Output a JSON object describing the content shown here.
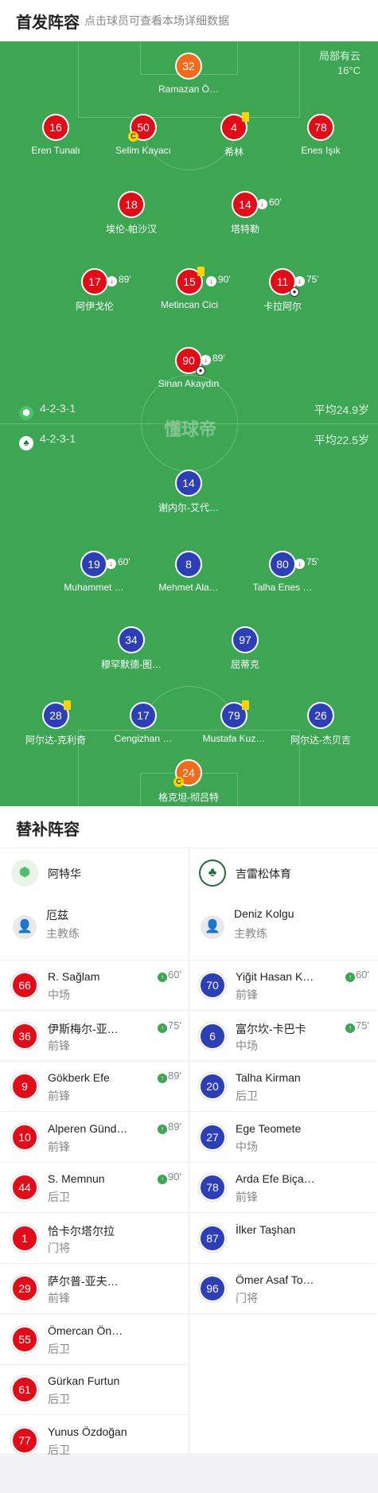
{
  "header": {
    "title": "首发阵容",
    "subtitle": "点击球员可查看本场详细数据"
  },
  "pitch": {
    "weather_label": "局部有云",
    "temperature": "16°C",
    "watermark": "懂球帝",
    "home_formation": "4-2-3-1",
    "home_avg_age": "平均24.9岁",
    "away_formation": "4-2-3-1",
    "away_avg_age": "平均22.5岁",
    "home_players": [
      {
        "num": "32",
        "name": "Ramazan Ö…",
        "role": "gk"
      },
      {
        "num": "16",
        "name": "Eren Tunalı"
      },
      {
        "num": "50",
        "name": "Selim Kayacı",
        "captain": "C"
      },
      {
        "num": "4",
        "name": "希林",
        "yellow": true
      },
      {
        "num": "78",
        "name": "Enes Işık"
      },
      {
        "num": "18",
        "name": "埃伦-帕沙汉"
      },
      {
        "num": "14",
        "name": "塔特勒",
        "sub_off": "60'"
      },
      {
        "num": "17",
        "name": "阿伊戈伦",
        "sub_off": "89'"
      },
      {
        "num": "15",
        "name": "Metincan Cici",
        "yellow": true,
        "sub_off": "90'"
      },
      {
        "num": "11",
        "name": "卡拉阿尔",
        "sub_off": "75'",
        "goal": true
      },
      {
        "num": "90",
        "name": "Sinan Akaydın",
        "sub_off": "89'",
        "goal": true
      }
    ],
    "away_players": [
      {
        "num": "14",
        "name": "谢内尔-艾代…"
      },
      {
        "num": "19",
        "name": "Muhammet …",
        "sub_off": "60'"
      },
      {
        "num": "8",
        "name": "Mehmet Ala…"
      },
      {
        "num": "80",
        "name": "Talha Enes …",
        "sub_off": "75'"
      },
      {
        "num": "34",
        "name": "穆罕默德-图…"
      },
      {
        "num": "97",
        "name": "屈蒂克"
      },
      {
        "num": "28",
        "name": "阿尔达-克利奇",
        "yellow": true
      },
      {
        "num": "17",
        "name": "Cengizhan …"
      },
      {
        "num": "79",
        "name": "Mustafa Kuz…",
        "yellow": true
      },
      {
        "num": "26",
        "name": "阿尔达-杰贝吉"
      },
      {
        "num": "24",
        "name": "格克坦-彻吕特",
        "role": "gk",
        "captain": "C"
      }
    ]
  },
  "substitutes": {
    "title": "替补阵容",
    "home": {
      "team_name": "阿特华",
      "coach_name": "厄兹",
      "coach_role": "主教练",
      "players": [
        {
          "num": "66",
          "name": "R. Sağlam",
          "pos": "中场",
          "minute": "60'"
        },
        {
          "num": "36",
          "name": "伊斯梅尔-亚…",
          "pos": "前锋",
          "minute": "75'"
        },
        {
          "num": "9",
          "name": "Gökberk Efe",
          "pos": "前锋",
          "minute": "89'"
        },
        {
          "num": "10",
          "name": "Alperen Günd…",
          "pos": "前锋",
          "minute": "89'"
        },
        {
          "num": "44",
          "name": "S. Memnun",
          "pos": "后卫",
          "minute": "90'"
        },
        {
          "num": "1",
          "name": "恰卡尔塔尔拉",
          "pos": "门将",
          "minute": ""
        },
        {
          "num": "29",
          "name": "萨尔普-亚夫…",
          "pos": "前锋",
          "minute": ""
        },
        {
          "num": "55",
          "name": "Ömercan Ön…",
          "pos": "后卫",
          "minute": ""
        },
        {
          "num": "61",
          "name": "Gürkan Furtun",
          "pos": "后卫",
          "minute": ""
        },
        {
          "num": "77",
          "name": "Yunus Özdoğan",
          "pos": "后卫",
          "minute": ""
        }
      ]
    },
    "away": {
      "team_name": "吉雷松体育",
      "coach_name": "Deniz Kolgu",
      "coach_role": "主教练",
      "players": [
        {
          "num": "70",
          "name": "Yiğit Hasan K…",
          "pos": "前锋",
          "minute": "60'"
        },
        {
          "num": "6",
          "name": "富尔坎-卡巴卡",
          "pos": "中场",
          "minute": "75'"
        },
        {
          "num": "20",
          "name": "Talha Kirman",
          "pos": "后卫",
          "minute": ""
        },
        {
          "num": "27",
          "name": "Ege Teomete",
          "pos": "中场",
          "minute": ""
        },
        {
          "num": "78",
          "name": "Arda Efe Biça…",
          "pos": "前锋",
          "minute": ""
        },
        {
          "num": "87",
          "name": "İlker Taşhan",
          "pos": "",
          "minute": ""
        },
        {
          "num": "96",
          "name": "Ömer Asaf To…",
          "pos": "门将",
          "minute": ""
        }
      ]
    }
  }
}
